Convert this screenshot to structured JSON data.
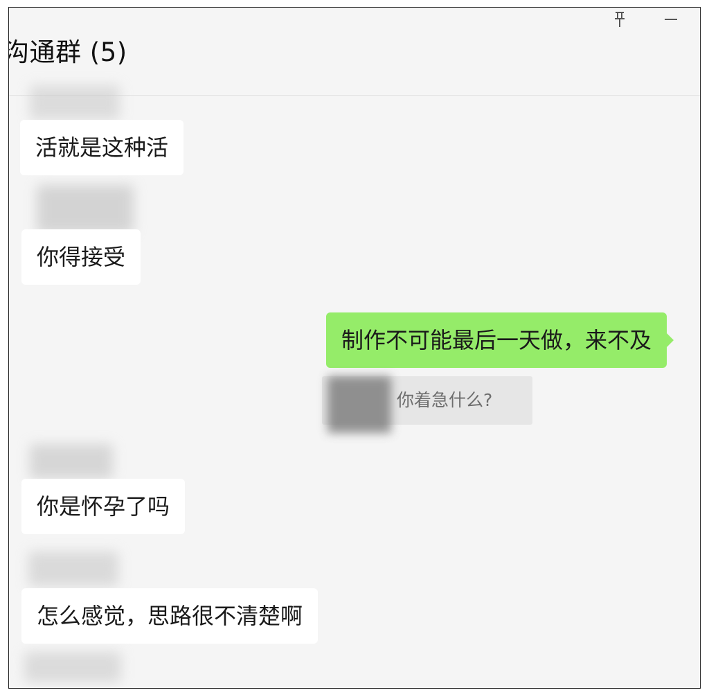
{
  "header": {
    "title": "沟通群 (5)",
    "pin_icon": "pin-icon",
    "minimize_icon": "minimize-icon"
  },
  "messages": [
    {
      "side": "left",
      "text": "活就是这种活"
    },
    {
      "side": "left",
      "text": "你得接受"
    },
    {
      "side": "right",
      "text": "制作不可能最后一天做，来不及"
    },
    {
      "side": "left",
      "text": "你是怀孕了吗"
    },
    {
      "side": "left",
      "text": "怎么感觉，思路很不清楚啊"
    }
  ],
  "quote": {
    "text": "你着急什么?"
  },
  "colors": {
    "background": "#f5f5f5",
    "incoming_bubble": "#ffffff",
    "outgoing_bubble": "#95ec69",
    "quote_background": "#e6e6e6"
  }
}
